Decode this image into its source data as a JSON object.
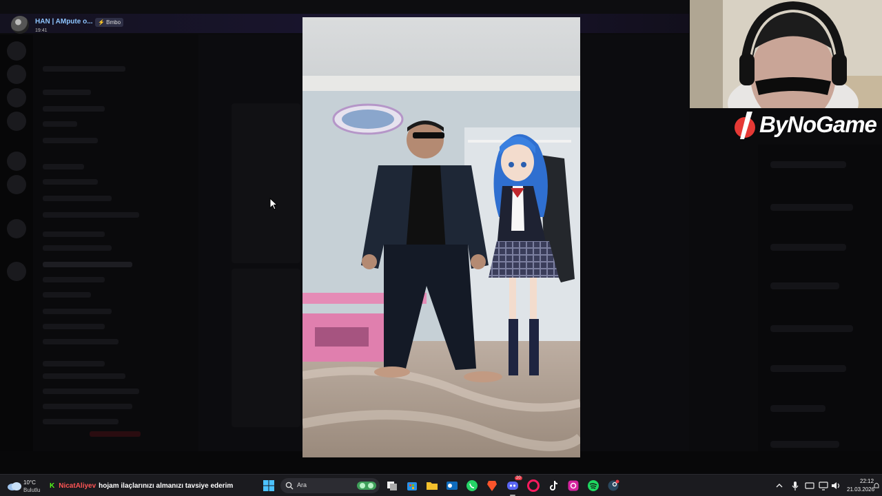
{
  "notification": {
    "author": "HAN | AMpute o...",
    "badge": "⚡ Bmbo",
    "time": "19:41"
  },
  "overlay": {
    "brand_name": "ByNoGame"
  },
  "taskbar": {
    "weather_temp": "10°C",
    "weather_condition": "Bulutlu",
    "ticker_user": "NicatAliyev",
    "ticker_message": "hojam ilaçlarınızı almanızı tavsiye ederim",
    "search_placeholder": "Ara",
    "clock_time": "22:12",
    "clock_date": "21.03.2026",
    "pinned_apps": [
      "windows-start",
      "search",
      "copilot",
      "task-view",
      "microsoft-store",
      "file-explorer",
      "outlook",
      "whatsapp",
      "brave",
      "discord",
      "opera-gx",
      "tiktok",
      "instagram",
      "spotify",
      "steam"
    ],
    "discord_badge": "20"
  },
  "colors": {
    "accent_kick": "#53fc18",
    "ticker_user": "#ff5555",
    "brand_red": "#e53935",
    "notification_name": "#8ec5ff"
  }
}
